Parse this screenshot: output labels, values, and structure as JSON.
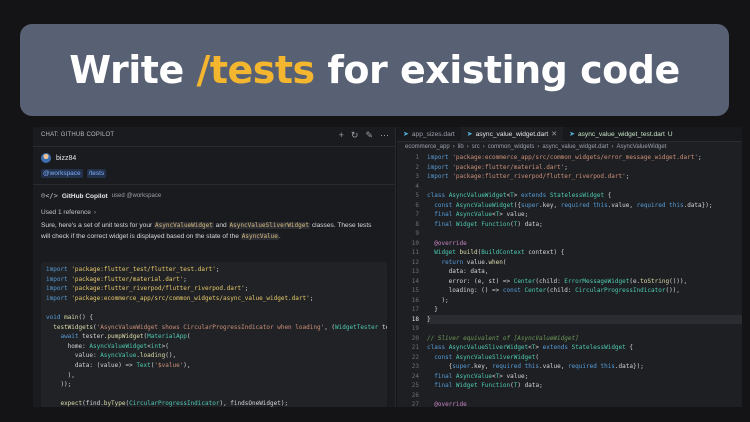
{
  "banner": {
    "prefix": "Write ",
    "accent": "/tests",
    "suffix": " for existing code"
  },
  "chat": {
    "title": "CHAT: GITHUB COPILOT",
    "user": "bizz84",
    "tags": [
      "@workspace",
      "/tests"
    ],
    "bot_name": "GitHub Copilot",
    "bot_sub": "used @workspace",
    "refs": "Used 1 reference",
    "response": {
      "p1": "Sure, here's a set of unit tests for your ",
      "c1": "AsyncValueWidget",
      "p2": " and ",
      "c2": "AsyncValueSliverWidget",
      "p3": " classes. These tests will check if the correct widget is displayed based on the state of the ",
      "c3": "AsyncValue",
      "p4": "."
    },
    "code_lines": [
      "import 'package:flutter_test/flutter_test.dart';",
      "import 'package:flutter/material.dart';",
      "import 'package:flutter_riverpod/flutter_riverpod.dart';",
      "import 'package:ecommerce_app/src/common_widgets/async_value_widget.dart';",
      "",
      "void main() {",
      "  testWidgets('AsyncValueWidget shows CircularProgressIndicator when loading', (WidgetTester te",
      "    await tester.pumpWidget(MaterialApp(",
      "      home: AsyncValueWidget<int>(",
      "        value: AsyncValue.loading(),",
      "        data: (value) => Text('$value'),",
      "      ),",
      "    ));",
      "",
      "    expect(find.byType(CircularProgressIndicator), findsOneWidget);",
      "  });"
    ]
  },
  "editor": {
    "tabs": [
      {
        "label": "app_sizes.dart",
        "active": false
      },
      {
        "label": "async_value_widget.dart",
        "active": true
      },
      {
        "label": "async_value_widget_test.dart",
        "active": false,
        "modified": "U"
      }
    ],
    "breadcrumbs": [
      "ecommerce_app",
      "lib",
      "src",
      "common_widgets",
      "async_value_widget.dart",
      "AsyncValueWidget"
    ],
    "line_numbers": [
      "1",
      "2",
      "3",
      "4",
      "5",
      "6",
      "7",
      "8",
      "9",
      "10",
      "11",
      "12",
      "13",
      "14",
      "15",
      "16",
      "17",
      "18",
      "19",
      "20",
      "21",
      "22",
      "23",
      "24",
      "25",
      "26",
      "27",
      "28"
    ],
    "current_line": 18,
    "lines": [
      "import 'package:ecommerce_app/src/common_widgets/error_message_widget.dart';",
      "import 'package:flutter/material.dart';",
      "import 'package:flutter_riverpod/flutter_riverpod.dart';",
      "",
      "class AsyncValueWidget<T> extends StatelessWidget {",
      "  const AsyncValueWidget({super.key, required this.value, required this.data});",
      "  final AsyncValue<T> value;",
      "  final Widget Function(T) data;",
      "",
      "  @override",
      "  Widget build(BuildContext context) {",
      "    return value.when(",
      "      data: data,",
      "      error: (e, st) => Center(child: ErrorMessageWidget(e.toString())),",
      "      loading: () => const Center(child: CircularProgressIndicator()),",
      "    );",
      "  }",
      "}",
      "",
      "// Sliver equivalent of [AsyncValueWidget]",
      "class AsyncValueSliverWidget<T> extends StatelessWidget {",
      "  const AsyncValueSliverWidget(",
      "      {super.key, required this.value, required this.data});",
      "  final AsyncValue<T> value;",
      "  final Widget Function(T) data;",
      "",
      "  @override",
      "  Widget build(BuildContext context) {"
    ]
  }
}
